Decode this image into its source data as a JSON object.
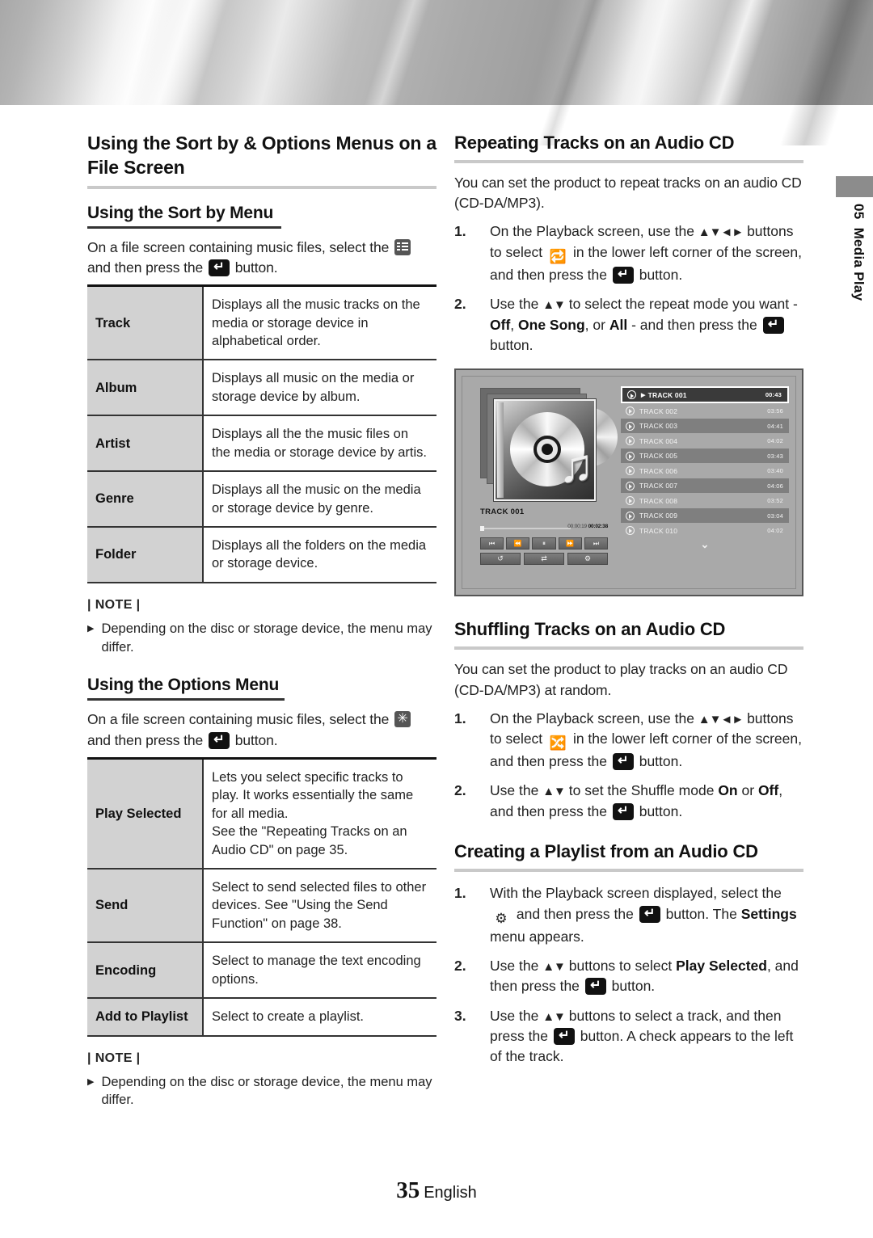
{
  "banner": {
    "name": "metallic-header-band"
  },
  "side_tab": {
    "chapter_number": "05",
    "chapter_title": "Media Play"
  },
  "left_column": {
    "section_title": "Using the Sort by & Options Menus on a File Screen",
    "sort_by": {
      "heading": "Using the Sort by Menu",
      "intro_before": "On a file screen containing music files, select the",
      "intro_middle": "and then press the",
      "intro_after": "button.",
      "rows": [
        {
          "key": "Track",
          "value": "Displays all the music tracks on the media or storage device in alphabetical order."
        },
        {
          "key": "Album",
          "value": "Displays all music on the media or storage device by album."
        },
        {
          "key": "Artist",
          "value": "Displays all the the music files on the media or storage device by artis."
        },
        {
          "key": "Genre",
          "value": "Displays all the music on the media or storage device by genre."
        },
        {
          "key": "Folder",
          "value": "Displays all the folders on the media or storage device."
        }
      ],
      "note_title": "| NOTE |",
      "note_items": [
        "Depending on the disc or storage device, the menu may differ."
      ]
    },
    "options": {
      "heading": "Using the Options Menu",
      "intro_before": "On a file screen containing music files, select the",
      "intro_middle": "and then press the",
      "intro_after": "button.",
      "rows": [
        {
          "key": "Play Selected",
          "value": "Lets you select specific tracks to play. It works essentially the same for all media.\nSee the \"Repeating Tracks on an Audio CD\" on page 35."
        },
        {
          "key": "Send",
          "value": "Select to send selected files to other devices. See \"Using the Send Function\" on page 38."
        },
        {
          "key": "Encoding",
          "value": "Select to manage the text encoding options."
        },
        {
          "key": "Add to Playlist",
          "value": "Select to create a playlist."
        }
      ],
      "note_title": "| NOTE |",
      "note_items": [
        "Depending on the disc or storage device, the menu may differ."
      ]
    }
  },
  "right_column": {
    "repeating": {
      "heading": "Repeating Tracks on an Audio CD",
      "intro": "You can set the product to repeat tracks on an audio CD (CD-DA/MP3).",
      "steps": [
        {
          "n": "1.",
          "p1": "On the Playback screen, use the",
          "arrows": "▲▼◄►",
          "p2": "buttons to select",
          "p3": "in the lower left corner of the screen, and then press the",
          "p4": "button."
        },
        {
          "n": "2.",
          "p1": "Use the",
          "arrows": "▲▼",
          "p2": "to select the repeat mode you want -",
          "b1": "Off",
          "b2": "One Song",
          "b3": "All",
          "p3": "- and then press the",
          "p4": "button."
        }
      ]
    },
    "figure": {
      "now_playing_label": "TRACK 001",
      "elapsed": "00:00:19",
      "total": "00:02:38",
      "transport_buttons": [
        "prev-track",
        "rewind",
        "pause",
        "fast-forward",
        "next-track"
      ],
      "mode_buttons": [
        "repeat",
        "shuffle",
        "settings"
      ],
      "tracks": [
        {
          "name": "TRACK 001",
          "time": "00:43",
          "state": "selected"
        },
        {
          "name": "TRACK 002",
          "time": "03:56",
          "state": "light"
        },
        {
          "name": "TRACK 003",
          "time": "04:41",
          "state": "dark"
        },
        {
          "name": "TRACK 004",
          "time": "04:02",
          "state": "light"
        },
        {
          "name": "TRACK 005",
          "time": "03:43",
          "state": "dark"
        },
        {
          "name": "TRACK 006",
          "time": "03:40",
          "state": "light"
        },
        {
          "name": "TRACK 007",
          "time": "04:06",
          "state": "dark"
        },
        {
          "name": "TRACK 008",
          "time": "03:52",
          "state": "light"
        },
        {
          "name": "TRACK 009",
          "time": "03:04",
          "state": "dark"
        },
        {
          "name": "TRACK 010",
          "time": "04:02",
          "state": "light"
        }
      ]
    },
    "shuffling": {
      "heading": "Shuffling Tracks on an Audio CD",
      "intro": "You can set the product to play tracks on an audio CD (CD-DA/MP3) at random.",
      "steps": [
        {
          "n": "1.",
          "p1": "On the Playback screen, use the",
          "arrows": "▲▼◄►",
          "p2": "buttons to select",
          "p3": "in the lower left corner of the screen, and then press the",
          "p4": "button."
        },
        {
          "n": "2.",
          "p1": "Use the",
          "arrows": "▲▼",
          "p2": "to set the Shuffle mode",
          "b1": "On",
          "p2b": "or",
          "b2": "Off",
          "p3": ", and then press the",
          "p4": "button."
        }
      ]
    },
    "playlist": {
      "heading": "Creating a Playlist from an Audio CD",
      "steps": [
        {
          "n": "1.",
          "p1": "With the Playback screen displayed, select the",
          "p2": "and then press the",
          "p3": "button. The",
          "b1": "Settings",
          "p4": "menu appears."
        },
        {
          "n": "2.",
          "p1": "Use the",
          "arrows": "▲▼",
          "p2": "buttons to select",
          "b1": "Play Selected",
          "p3": ", and then press the",
          "p4": "button."
        },
        {
          "n": "3.",
          "p1": "Use the",
          "arrows": "▲▼",
          "p2": "buttons to select a track, and then press the",
          "p3": "button. A check appears to the left of the track."
        }
      ]
    }
  },
  "footer": {
    "page_number": "35",
    "language": "English"
  }
}
